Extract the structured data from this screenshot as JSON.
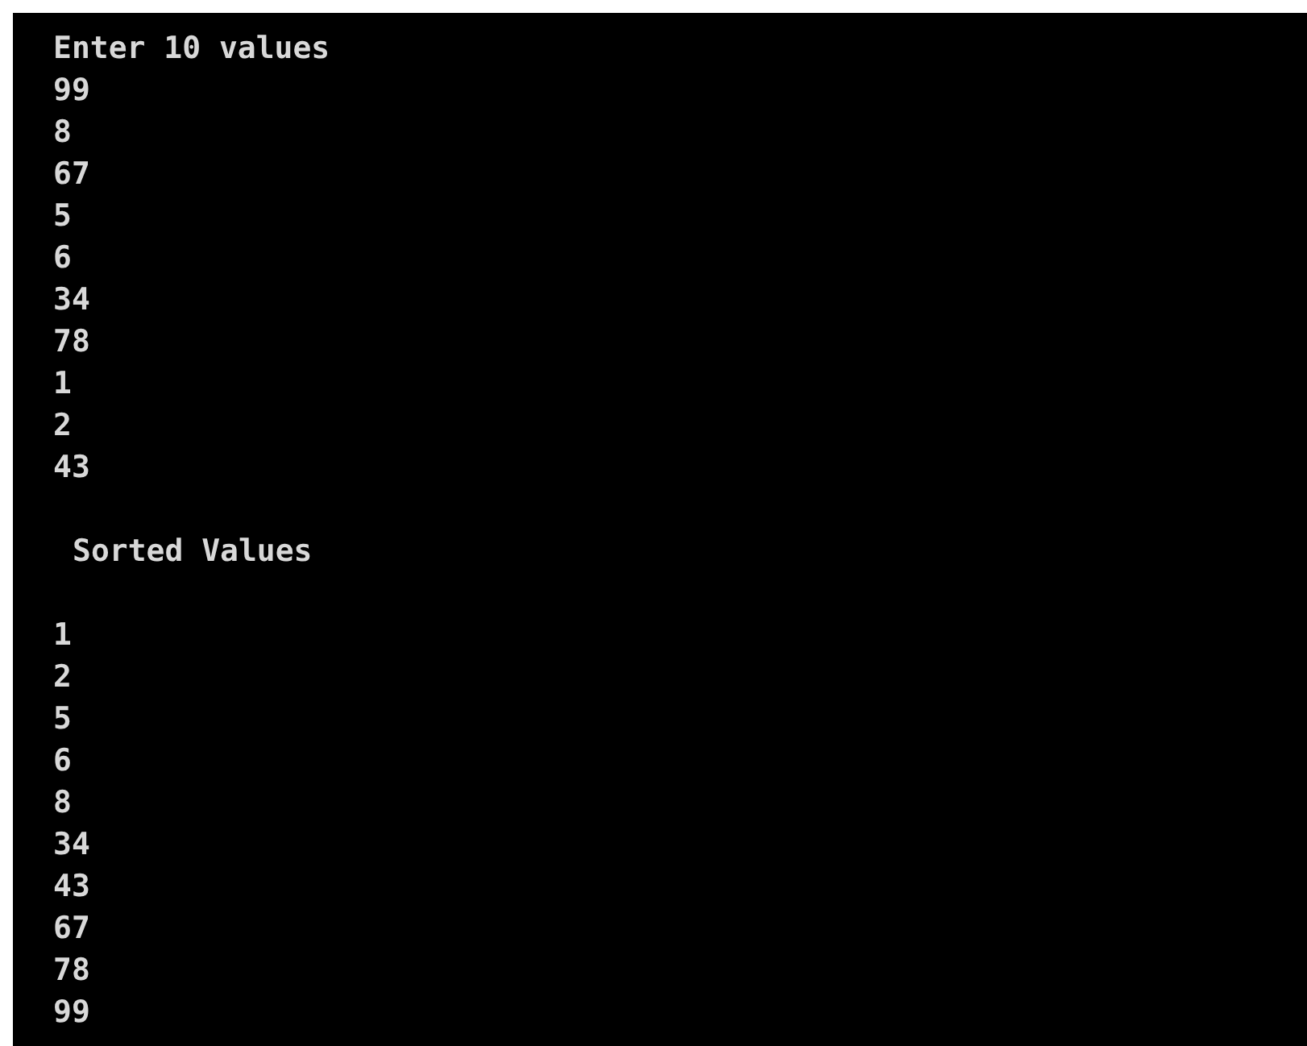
{
  "console": {
    "input": {
      "prompt": "Enter 10 values",
      "values": [
        "99",
        "8",
        "67",
        "5",
        "6",
        "34",
        "78",
        "1",
        "2",
        "43"
      ]
    },
    "output": {
      "heading": "Sorted Values",
      "values": [
        "1",
        "2",
        "5",
        "6",
        "8",
        "34",
        "43",
        "67",
        "78",
        "99"
      ]
    }
  }
}
